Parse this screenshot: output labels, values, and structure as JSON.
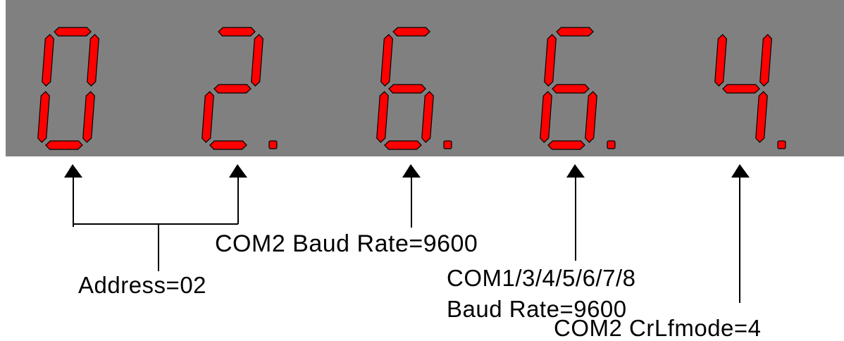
{
  "display": {
    "background_color": "#808080",
    "segment_color": "#ff0000",
    "outline_color": "#000000",
    "digits": [
      {
        "char": "0",
        "dot": false
      },
      {
        "char": "2",
        "dot": true
      },
      {
        "char": "6",
        "dot": true
      },
      {
        "char": "6",
        "dot": true
      },
      {
        "char": "4",
        "dot": true
      }
    ]
  },
  "annotations": {
    "address": "Address=02",
    "com2_baud": "COM2 Baud Rate=9600",
    "com1_ports": "COM1/3/4/5/6/7/8",
    "com1_baud": "Baud Rate=9600",
    "com2_crlf": "COM2 CrLfmode=4"
  }
}
